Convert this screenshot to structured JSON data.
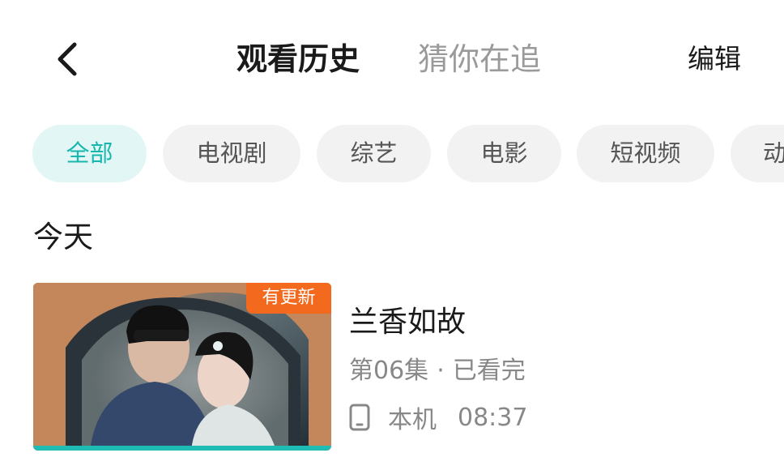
{
  "header": {
    "back_icon": "chevron-left-icon",
    "tabs": [
      {
        "label": "观看历史",
        "active": true
      },
      {
        "label": "猜你在追",
        "active": false
      }
    ],
    "edit_label": "编辑"
  },
  "filters": [
    {
      "label": "全部",
      "active": true
    },
    {
      "label": "电视剧",
      "active": false
    },
    {
      "label": "综艺",
      "active": false
    },
    {
      "label": "电影",
      "active": false
    },
    {
      "label": "短视频",
      "active": false
    },
    {
      "label": "动",
      "active": false
    }
  ],
  "sections": [
    {
      "title": "今天",
      "items": [
        {
          "badge": "有更新",
          "title": "兰香如故",
          "episode": "第06集",
          "separator": "·",
          "status": "已看完",
          "device_icon": "phone-icon",
          "device": "本机",
          "time": "08:37",
          "progress": 1.0
        }
      ]
    }
  ],
  "colors": {
    "accent": "#17b7ae",
    "accent_bg": "#e2f6f5",
    "badge": "#f36a1e",
    "chip_bg": "#f2f2f2",
    "muted_text": "#888888"
  }
}
